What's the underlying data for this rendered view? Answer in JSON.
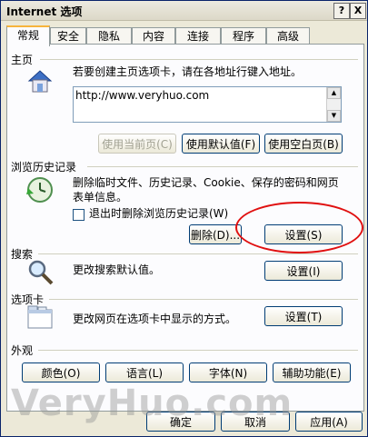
{
  "window": {
    "title": "Internet 选项",
    "help_btn": "?",
    "close_btn": "X"
  },
  "tabs": [
    "常规",
    "安全",
    "隐私",
    "内容",
    "连接",
    "程序",
    "高级"
  ],
  "homepage": {
    "section": "主页",
    "desc": "若要创建主页选项卡，请在各地址行键入地址。",
    "url": "http://www.veryhuo.com",
    "btn_current": "使用当前页(C)",
    "btn_default": "使用默认值(F)",
    "btn_blank": "使用空白页(B)"
  },
  "history": {
    "section": "浏览历史记录",
    "desc_line1": "删除临时文件、历史记录、Cookie、保存的密码和网页",
    "desc_line2": "表单信息。",
    "checkbox_label": "退出时删除浏览历史记录(W)",
    "btn_delete": "删除(D)...",
    "btn_settings": "设置(S)"
  },
  "search": {
    "section": "搜索",
    "desc": "更改搜索默认值。",
    "btn_settings": "设置(I)"
  },
  "tabs_section": {
    "section": "选项卡",
    "desc": "更改网页在选项卡中显示的方式。",
    "btn_settings": "设置(T)"
  },
  "appearance": {
    "section": "外观",
    "btn_colors": "颜色(O)",
    "btn_languages": "语言(L)",
    "btn_fonts": "字体(N)",
    "btn_accessibility": "辅助功能(E)"
  },
  "footer": {
    "ok": "确定",
    "cancel": "取消",
    "apply": "应用(A)"
  },
  "watermark": "VeryHuo.com",
  "colors": {
    "highlight_oval": "#e01010",
    "active_tab_accent": "#f7b43c"
  }
}
